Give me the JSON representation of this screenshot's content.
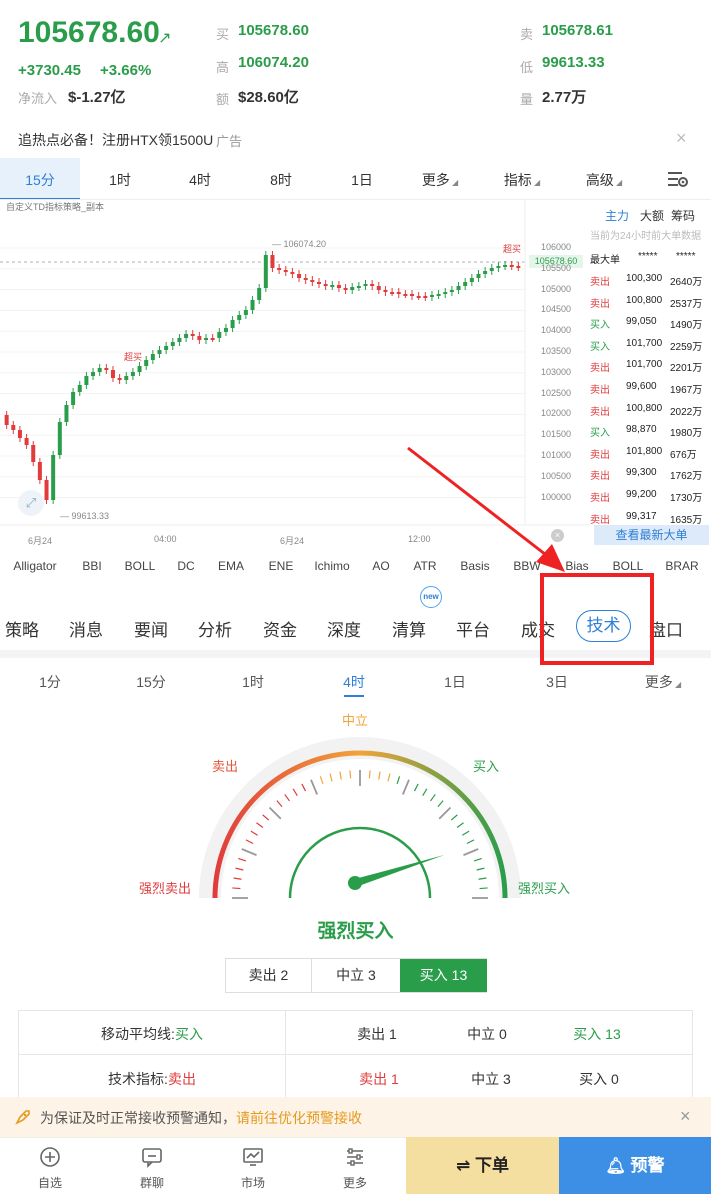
{
  "header": {
    "price": "105678.60",
    "change_abs": "+3730.45",
    "change_pct": "+3.66%",
    "net_inflow_label": "净流入",
    "net_inflow_value": "$-1.27亿",
    "bid_label": "买",
    "bid_value": "105678.60",
    "ask_label": "卖",
    "ask_value": "105678.61",
    "high_label": "高",
    "high_value": "106074.20",
    "low_label": "低",
    "low_value": "99613.33",
    "amount_label": "额",
    "amount_value": "$28.60亿",
    "volume_label": "量",
    "volume_value": "2.77万"
  },
  "ad": {
    "text": "追热点必备！注册HTX领1500U",
    "tag": "广告",
    "close": "×"
  },
  "timeframes": [
    "15分",
    "1时",
    "4时",
    "8时",
    "1日",
    "更多",
    "指标",
    "高级"
  ],
  "chart": {
    "strategy_label": "自定义TD指标策略_副本",
    "high_marker": "106074.20",
    "low_marker": "99613.33",
    "last_price_tag": "105678.60",
    "super_buy_label": "超买",
    "y_ticks": [
      "106000",
      "105500",
      "105000",
      "104500",
      "104000",
      "103500",
      "103000",
      "102500",
      "102000",
      "101500",
      "101000",
      "100500",
      "100000"
    ],
    "x_ticks": [
      "6月24",
      "04:00",
      "6月24",
      "12:00"
    ]
  },
  "chart_data": {
    "type": "candlestick",
    "title": "",
    "xlabel": "",
    "ylabel": "",
    "ylim": [
      99500,
      106300
    ],
    "x_ticks": [
      "6月24",
      "04:00",
      "6月24",
      "12:00"
    ],
    "high": 106074.2,
    "low": 99613.33,
    "last": 105678.6
  },
  "big_orders": {
    "tabs": [
      "主力",
      "大额",
      "筹码"
    ],
    "subtitle": "当前为24小时前大单数据",
    "head": {
      "label": "最大单",
      "v1": "*****",
      "v2": "*****"
    },
    "rows": [
      {
        "side": "卖出",
        "price": "100,300",
        "amount": "2640万"
      },
      {
        "side": "卖出",
        "price": "100,800",
        "amount": "2537万"
      },
      {
        "side": "买入",
        "price": "99,050",
        "amount": "1490万"
      },
      {
        "side": "买入",
        "price": "101,700",
        "amount": "2259万"
      },
      {
        "side": "卖出",
        "price": "101,700",
        "amount": "2201万"
      },
      {
        "side": "卖出",
        "price": "99,600",
        "amount": "1967万"
      },
      {
        "side": "卖出",
        "price": "100,800",
        "amount": "2022万"
      },
      {
        "side": "买入",
        "price": "98,870",
        "amount": "1980万"
      },
      {
        "side": "卖出",
        "price": "101,800",
        "amount": "676万"
      },
      {
        "side": "卖出",
        "price": "99,300",
        "amount": "1762万"
      },
      {
        "side": "卖出",
        "price": "99,200",
        "amount": "1730万"
      },
      {
        "side": "卖出",
        "price": "99,317",
        "amount": "1635万"
      }
    ],
    "latest_button": "查看最新大单"
  },
  "indicators": [
    "Alligator",
    "BBI",
    "BOLL",
    "DC",
    "EMA",
    "ENE",
    "Ichimo",
    "AO",
    "ATR",
    "Basis",
    "BBW",
    "Bias",
    "BOLL",
    "BRAR"
  ],
  "main_tabs": [
    "策略",
    "消息",
    "要闻",
    "分析",
    "资金",
    "深度",
    "清算",
    "平台",
    "成交",
    "技术",
    "盘口"
  ],
  "new_badge": "new",
  "sub_timeframes": [
    "1分",
    "15分",
    "1时",
    "4时",
    "1日",
    "3日",
    "更多"
  ],
  "gauge": {
    "neutral": "中立",
    "sell": "卖出",
    "buy": "买入",
    "strong_sell": "强烈卖出",
    "strong_buy": "强烈买入",
    "verdict": "强烈买入",
    "needle_value": 0.85
  },
  "segmented": {
    "sell": "卖出 2",
    "neutral": "中立 3",
    "buy": "买入 13"
  },
  "summary_table": {
    "row1": {
      "label": "移动平均线:",
      "signal": "买入",
      "sell": "卖出 1",
      "neutral": "中立 0",
      "buy": "买入 13"
    },
    "row2": {
      "label": "技术指标:",
      "signal": "卖出",
      "sell": "卖出 1",
      "neutral": "中立 3",
      "buy": "买入 0"
    }
  },
  "notice": {
    "text": "为保证及时正常接收预警通知，",
    "link": "请前往优化预警接收",
    "close": "×"
  },
  "bottom_nav": {
    "watchlist": "自选",
    "chat": "群聊",
    "market": "市场",
    "more": "更多",
    "order": "⇌ 下单",
    "alert": "预警"
  },
  "colors": {
    "green": "#2a9d4b",
    "red": "#e03c3c",
    "blue": "#2e7fd6",
    "annotation_red": "#ee2222"
  }
}
